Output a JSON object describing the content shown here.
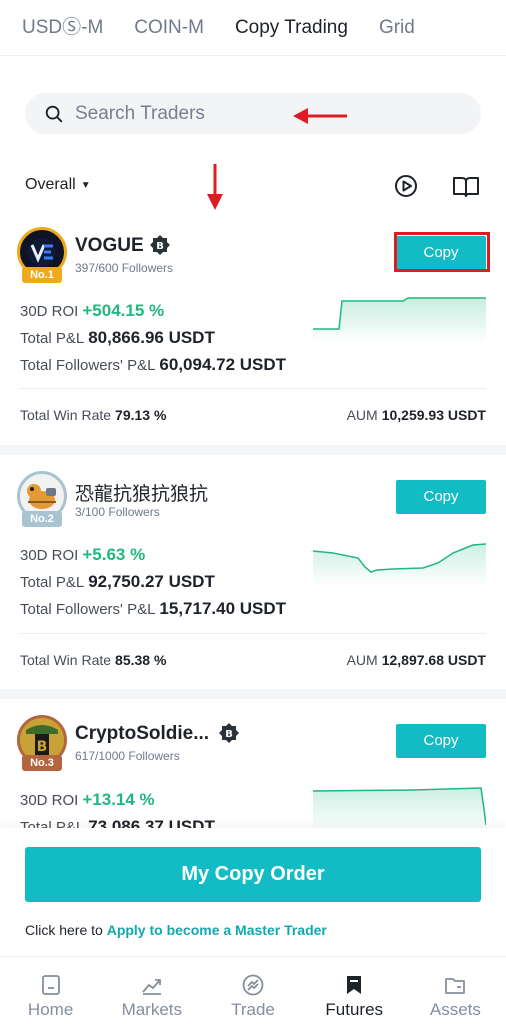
{
  "tabs": [
    {
      "label": "USDⓈ-M"
    },
    {
      "label": "COIN-M"
    },
    {
      "label": "Copy Trading"
    },
    {
      "label": "Grid"
    }
  ],
  "search": {
    "placeholder": "Search Traders"
  },
  "filter": {
    "label": "Overall"
  },
  "toolbar": {
    "play_icon": "play-circle-icon",
    "guide_icon": "book-icon"
  },
  "traders": [
    {
      "rank": "No.1",
      "name": "VOGUE",
      "followers": "397/600 Followers",
      "copy_label": "Copy",
      "roi_label": "30D ROI",
      "roi": "+504.15 %",
      "pnl_label": "Total P&L",
      "pnl": "80,866.96 USDT",
      "fpnl_label": "Total Followers' P&L",
      "fpnl": "60,094.72 USDT",
      "winrate_label": "Total Win Rate",
      "winrate": "79.13 %",
      "aum_label": "AUM",
      "aum": "10,259.93 USDT"
    },
    {
      "rank": "No.2",
      "name": "恐龍抗狼抗狼抗",
      "followers": "3/100 Followers",
      "copy_label": "Copy",
      "roi_label": "30D ROI",
      "roi": "+5.63 %",
      "pnl_label": "Total P&L",
      "pnl": "92,750.27 USDT",
      "fpnl_label": "Total Followers' P&L",
      "fpnl": "15,717.40 USDT",
      "winrate_label": "Total Win Rate",
      "winrate": "85.38 %",
      "aum_label": "AUM",
      "aum": "12,897.68 USDT"
    },
    {
      "rank": "No.3",
      "name": "CryptoSoldie...",
      "followers": "617/1000 Followers",
      "copy_label": "Copy",
      "roi_label": "30D ROI",
      "roi": "+13.14 %",
      "pnl_label": "Total P&L",
      "pnl": "73,086.37 USDT"
    }
  ],
  "bottom": {
    "main_button": "My Copy Order",
    "apply_prefix": "Click here to ",
    "apply_link": "Apply to become a Master Trader"
  },
  "nav": [
    {
      "label": "Home",
      "icon": "home-icon"
    },
    {
      "label": "Markets",
      "icon": "markets-icon"
    },
    {
      "label": "Trade",
      "icon": "trade-icon"
    },
    {
      "label": "Futures",
      "icon": "futures-icon"
    },
    {
      "label": "Assets",
      "icon": "assets-icon"
    }
  ],
  "colors": {
    "accent": "#13bcc4",
    "positive": "#1fb87f",
    "highlight": "#e01b24",
    "gold": "#f0a91b",
    "silver": "#a9c4d0",
    "bronze": "#b4653d"
  }
}
